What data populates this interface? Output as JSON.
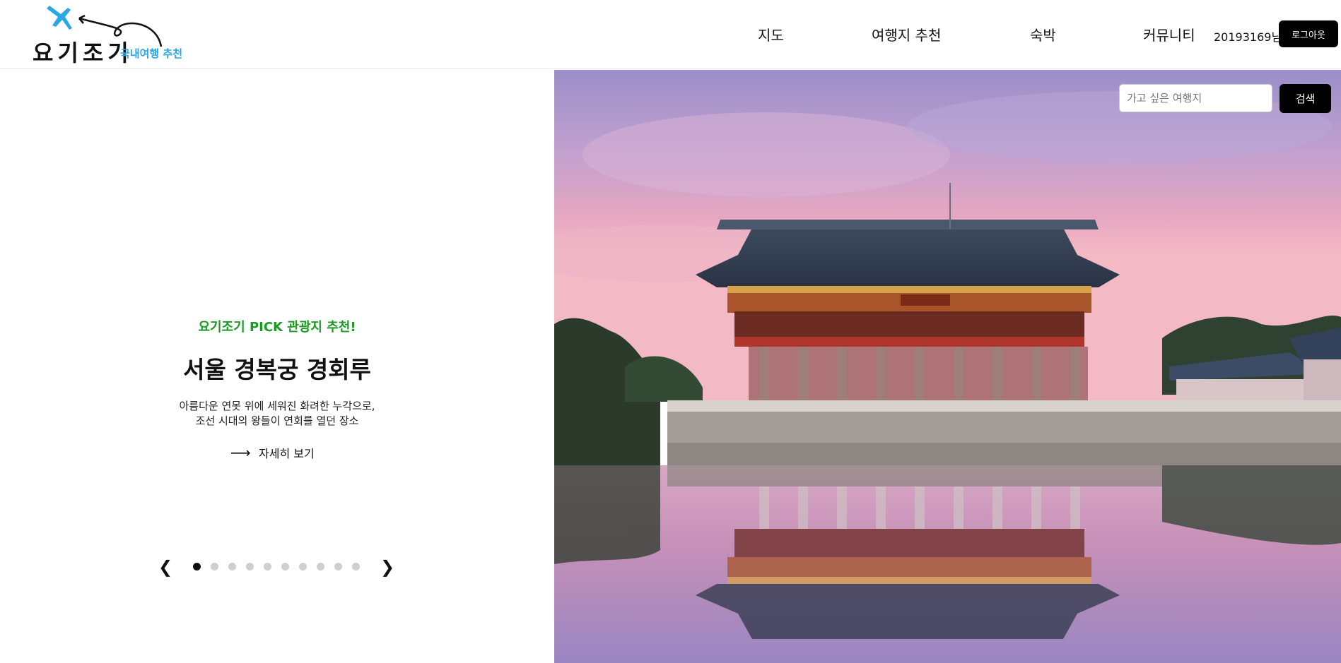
{
  "header": {
    "logo_text": "요기조기",
    "logo_subtitle": "국내여행 추천",
    "nav": [
      {
        "label": "지도"
      },
      {
        "label": "여행지 추천"
      },
      {
        "label": "숙박"
      },
      {
        "label": "커뮤니티"
      }
    ],
    "user_label": "20193169님",
    "logout_label": "로그아웃"
  },
  "search": {
    "placeholder": "가고 싶은 여행지",
    "value": "",
    "button_label": "검색"
  },
  "feature": {
    "pick_label": "요기조기 PICK 관광지 추천!",
    "title": "서울 경복궁 경회루",
    "desc_line1": "아름다운 연못 위에 세워진 화려한 누각으로,",
    "desc_line2": "조선 시대의 왕들이 연회를 열던 장소",
    "more_arrow": "⟶",
    "more_label": "자세히 보기"
  },
  "slider": {
    "prev_symbol": "❮",
    "next_symbol": "❯",
    "total_slides": 10,
    "active_index": 0
  },
  "colors": {
    "accent_green": "#1b9a23",
    "logo_blue": "#2aa7e6",
    "button_black": "#000000"
  }
}
